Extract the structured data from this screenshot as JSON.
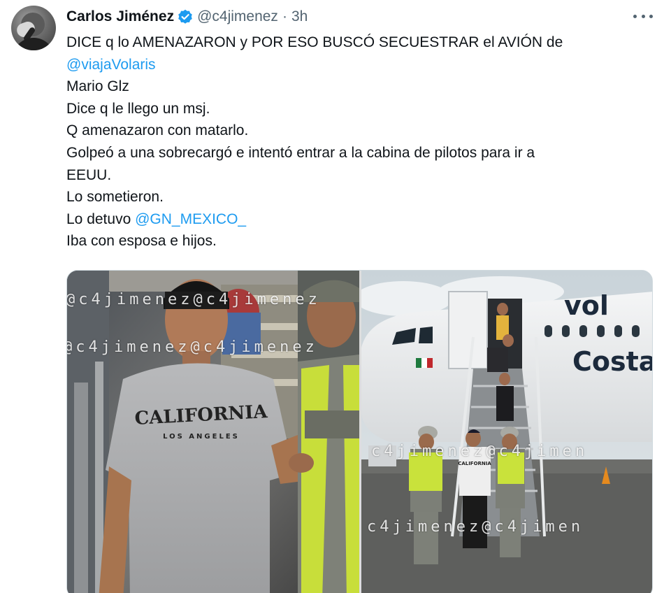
{
  "tweet": {
    "author": {
      "name": "Carlos Jiménez",
      "handle": "@c4jimenez",
      "separator": "·",
      "time": "3h"
    },
    "text": {
      "line1_pre": "DICE q lo AMENAZARON y POR ESO BUSCÓ SECUESTRAR el AVIÓN de",
      "line2_mention": "@viajaVolaris",
      "line3": "Mario Glz",
      "line4": "Dice q le llego un msj.",
      "line5": "Q amenazaron con matarlo.",
      "line6": "Golpeó a una sobrecargó e intentó entrar a la cabina de pilotos para ir a",
      "line7": "EEUU.",
      "line8": "Lo sometieron.",
      "line9_pre": "Lo detuvo ",
      "line9_mention": "@GN_MEXICO_",
      "line10": "Iba con esposa e hijos."
    },
    "media": {
      "left": {
        "shirt_text": "CALIFORNIA",
        "shirt_subtext": "LOS ANGELES",
        "watermark1": "@c4jimenez@c4jimenez",
        "watermark2": "@c4jimenez@c4jimenez"
      },
      "right": {
        "aircraft_brand": "vol",
        "aircraft_name": "Costa",
        "shirt_text": "CALIFORNIA",
        "watermark1": "c4jimenez@c4jimen",
        "watermark2": "c4jimenez@c4jimen"
      }
    }
  },
  "colors": {
    "text": "#0f1419",
    "secondary": "#536471",
    "link": "#1d9bf0",
    "verified": "#1d9bf0"
  },
  "icons": {
    "verified": "verified-badge-icon",
    "more": "more-options-icon"
  }
}
